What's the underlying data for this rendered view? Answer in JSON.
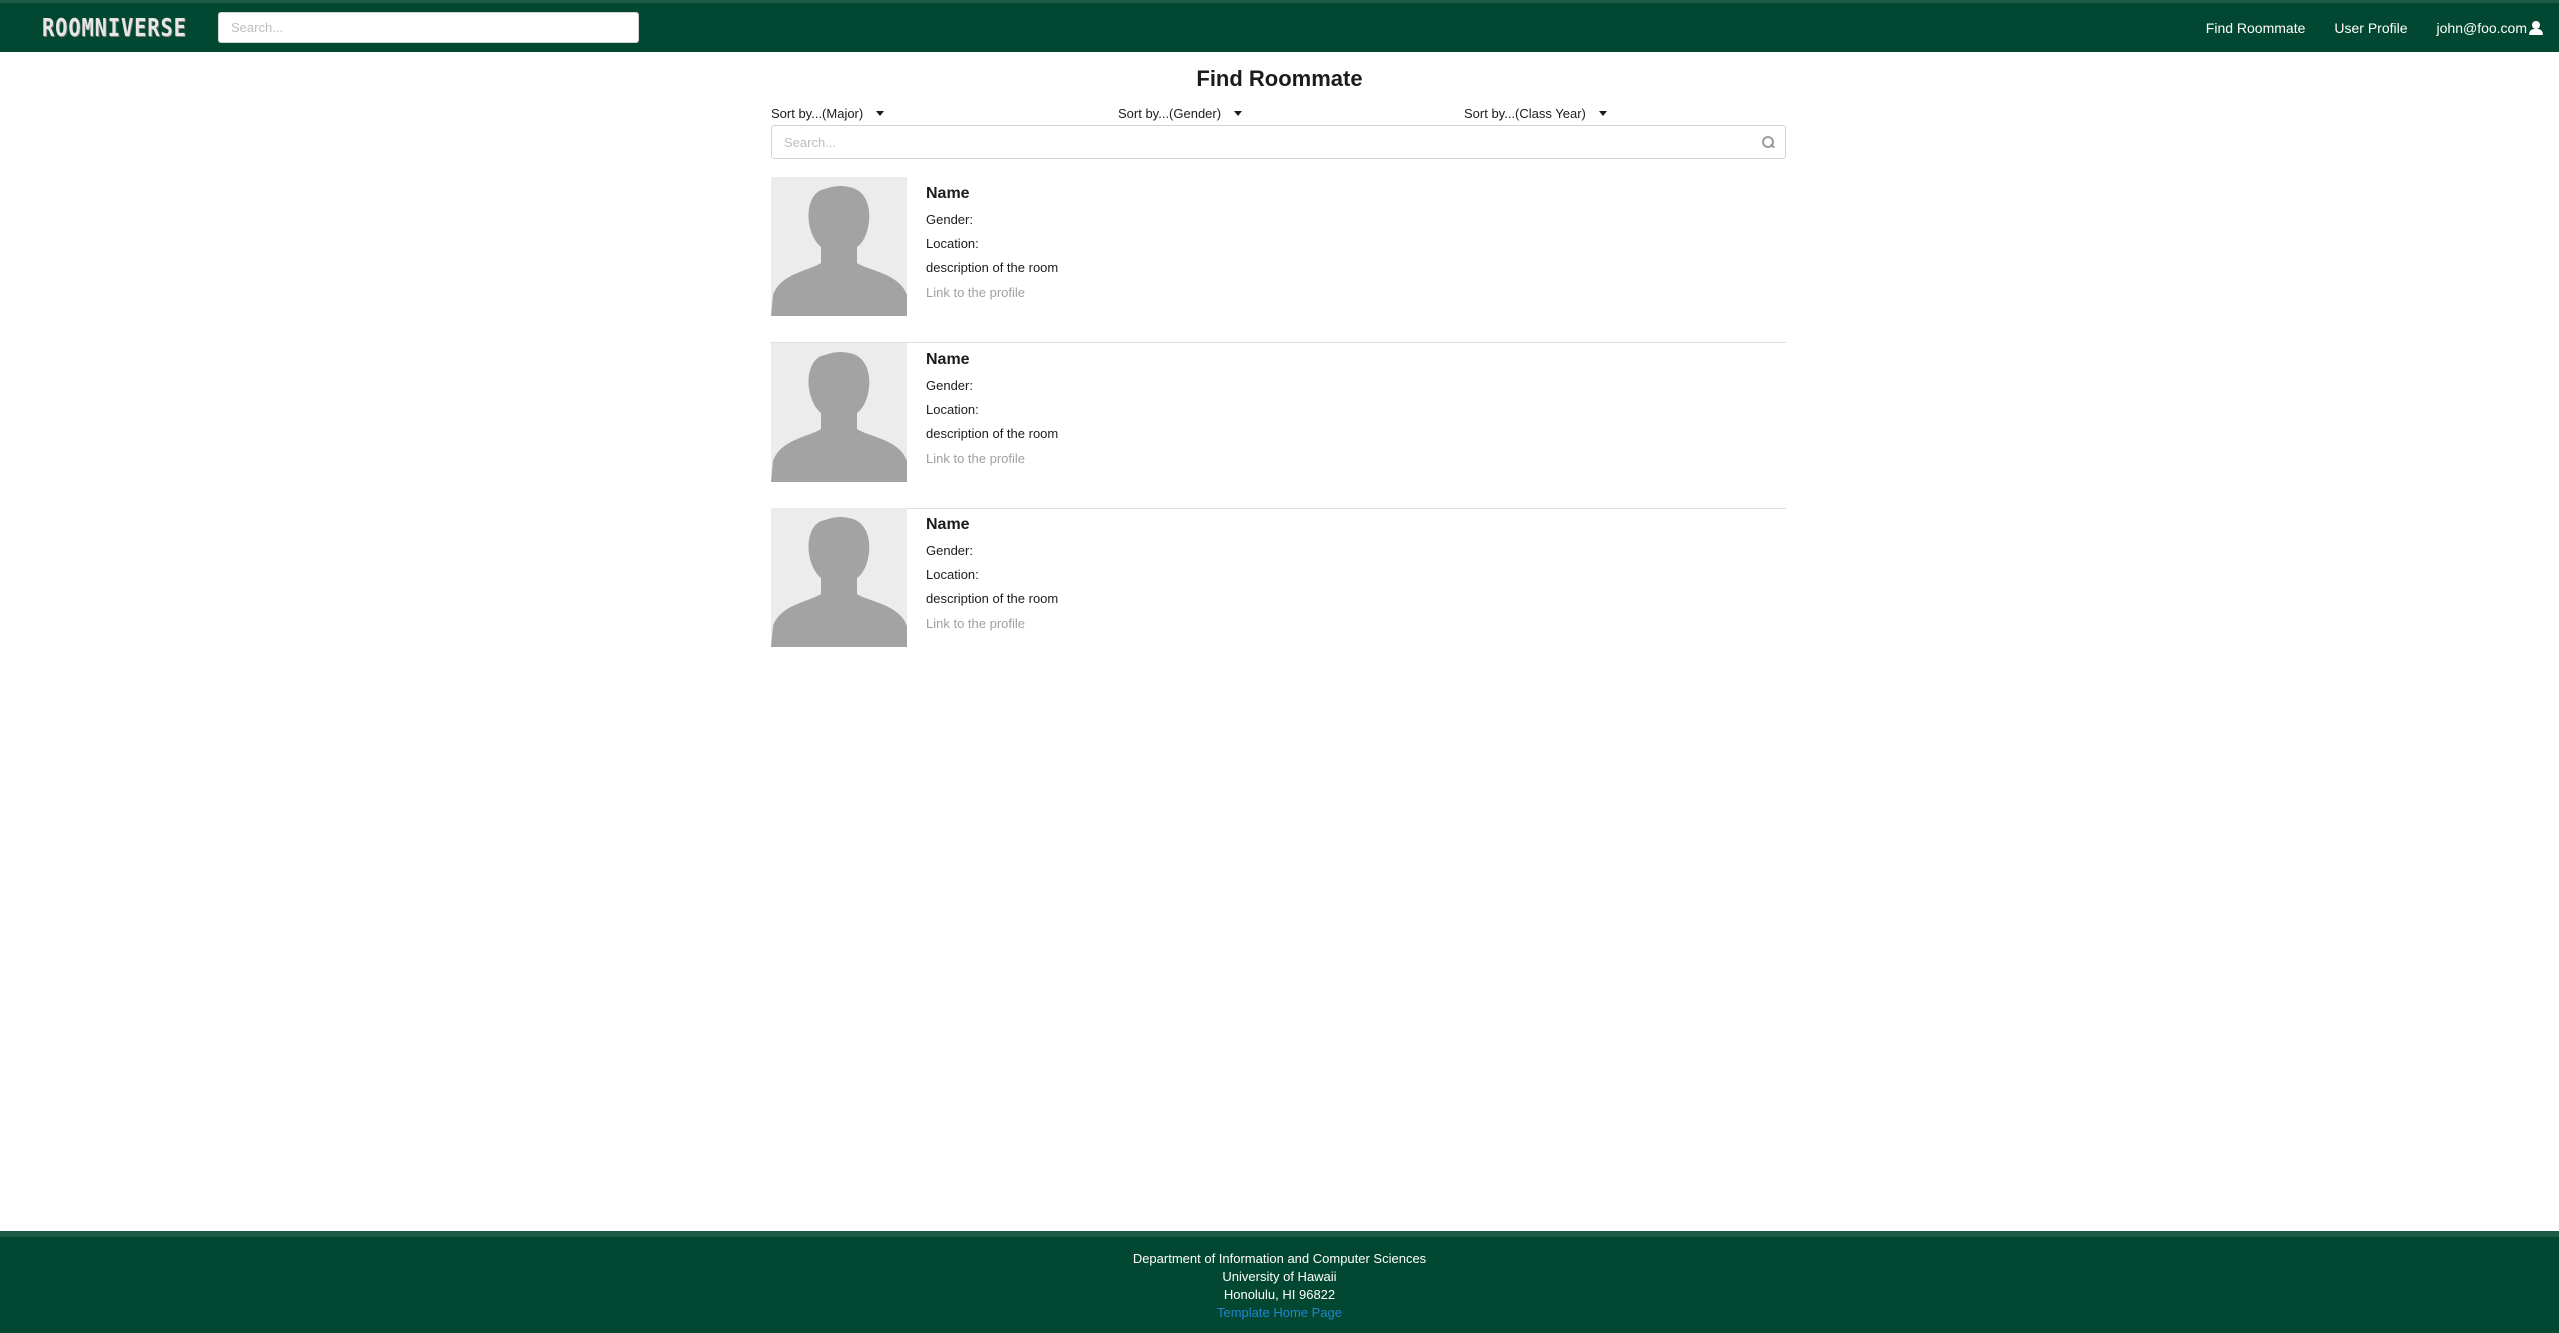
{
  "navbar": {
    "logo_text": "ROOMNIVERSE",
    "search_placeholder": "Search...",
    "links": [
      "Find Roommate",
      "User Profile",
      "john@foo.com"
    ]
  },
  "main": {
    "title": "Find Roommate",
    "sort": [
      "Sort by...(Major)",
      "Sort by...(Gender)",
      "Sort by...(Class Year)"
    ],
    "search_placeholder": "Search...",
    "items": [
      {
        "name": "Name",
        "gender": "Gender:",
        "location": "Location:",
        "description": "description of the room",
        "link": "Link to the profile"
      },
      {
        "name": "Name",
        "gender": "Gender:",
        "location": "Location:",
        "description": "description of the room",
        "link": "Link to the profile"
      },
      {
        "name": "Name",
        "gender": "Gender:",
        "location": "Location:",
        "description": "description of the room",
        "link": "Link to the profile"
      }
    ]
  },
  "footer": {
    "lines": [
      "Department of Information and Computer Sciences",
      "University of Hawaii",
      "Honolulu, HI 96822"
    ],
    "link": "Template Home Page"
  },
  "colors": {
    "brand_green": "#024731",
    "link_blue": "#2185d0",
    "avatar_gray": "#a3a3a3"
  },
  "icons": [
    "user-icon",
    "search-icon",
    "caret-down-icon",
    "avatar-placeholder"
  ]
}
